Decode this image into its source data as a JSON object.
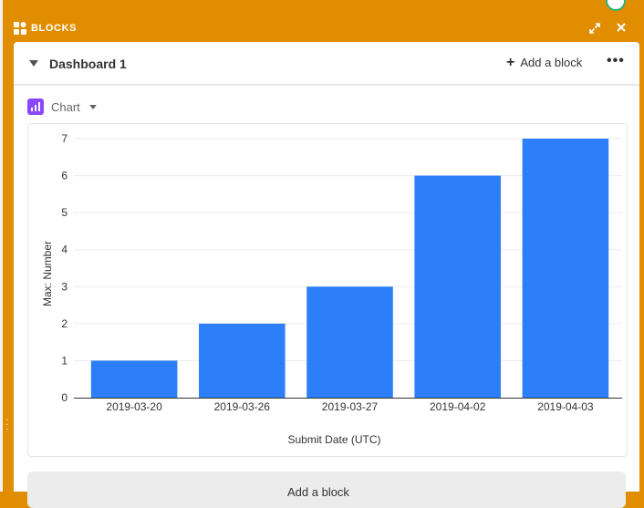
{
  "window": {
    "title": "BLOCKS"
  },
  "dashboard": {
    "title": "Dashboard 1",
    "add_block_label": "Add a block",
    "more_label": "•••"
  },
  "block": {
    "type_label": "Chart"
  },
  "next_block": {
    "label": "Add a block"
  },
  "colors": {
    "window_bar": "#e08e00",
    "bar": "#2d7ff9",
    "chart_icon": "#8b46ff"
  },
  "chart_data": {
    "type": "bar",
    "categories": [
      "2019-03-20",
      "2019-03-26",
      "2019-03-27",
      "2019-04-02",
      "2019-04-03"
    ],
    "values": [
      1,
      2,
      3,
      6,
      7
    ],
    "title": "",
    "xlabel": "Submit Date (UTC)",
    "ylabel": "Max: Number",
    "ylim": [
      0,
      7
    ],
    "yticks": [
      0,
      1,
      2,
      3,
      4,
      5,
      6,
      7
    ],
    "grid": true,
    "legend": "none"
  }
}
